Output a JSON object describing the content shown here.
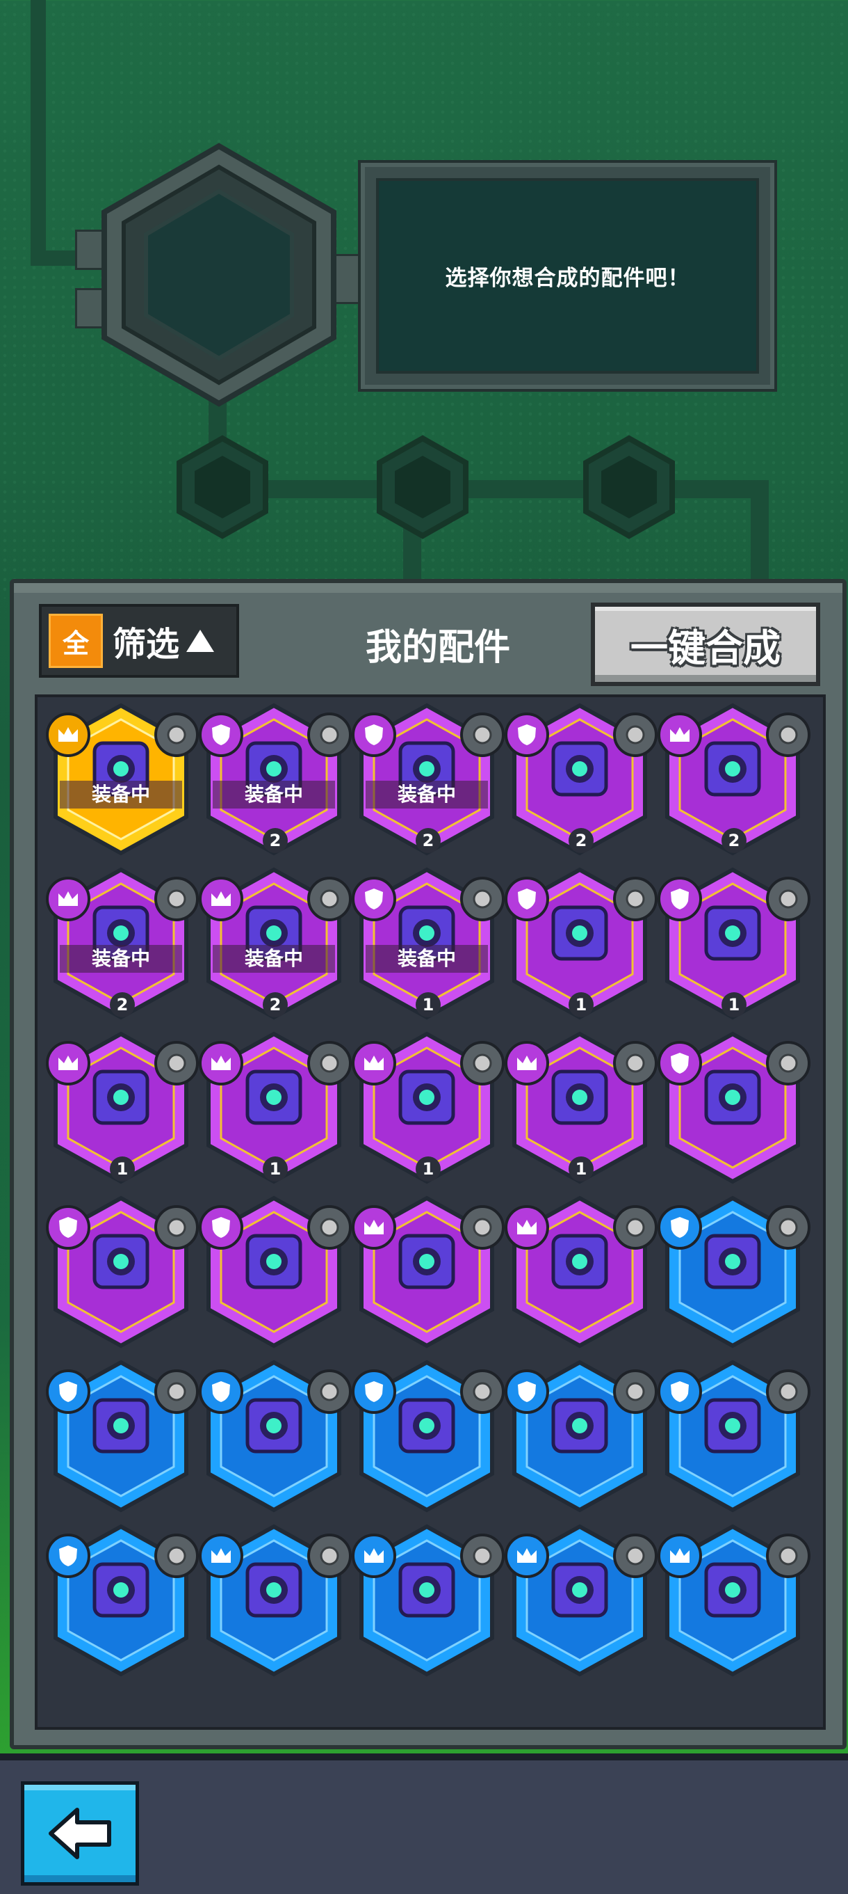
{
  "synth": {
    "prompt": "选择你想合成的配件吧！"
  },
  "panel": {
    "filter_all": "全",
    "filter_label": "筛选",
    "title": "我的配件",
    "merge_button": "一键合成"
  },
  "colors": {
    "gold": "#ffc400",
    "purple": "#b43bdc",
    "blue": "#1b8ff0",
    "accent": "#f38b0b"
  },
  "rows": [
    [
      {
        "rarity": "gold",
        "badge": "crown",
        "equipped": "装备中",
        "count": ""
      },
      {
        "rarity": "purple",
        "badge": "shield",
        "equipped": "装备中",
        "count": "2"
      },
      {
        "rarity": "purple",
        "badge": "shield",
        "equipped": "装备中",
        "count": "2"
      },
      {
        "rarity": "purple",
        "badge": "shield",
        "equipped": "",
        "count": "2"
      },
      {
        "rarity": "purple",
        "badge": "crown",
        "equipped": "",
        "count": "2"
      }
    ],
    [
      {
        "rarity": "purple",
        "badge": "crown",
        "equipped": "装备中",
        "count": "2"
      },
      {
        "rarity": "purple",
        "badge": "crown",
        "equipped": "装备中",
        "count": "2"
      },
      {
        "rarity": "purple",
        "badge": "shield",
        "equipped": "装备中",
        "count": "1"
      },
      {
        "rarity": "purple",
        "badge": "shield",
        "equipped": "",
        "count": "1"
      },
      {
        "rarity": "purple",
        "badge": "shield",
        "equipped": "",
        "count": "1"
      }
    ],
    [
      {
        "rarity": "purple",
        "badge": "crown",
        "equipped": "",
        "count": "1"
      },
      {
        "rarity": "purple",
        "badge": "crown",
        "equipped": "",
        "count": "1"
      },
      {
        "rarity": "purple",
        "badge": "crown",
        "equipped": "",
        "count": "1"
      },
      {
        "rarity": "purple",
        "badge": "crown",
        "equipped": "",
        "count": "1"
      },
      {
        "rarity": "purple",
        "badge": "shield",
        "equipped": "",
        "count": ""
      }
    ],
    [
      {
        "rarity": "purple",
        "badge": "shield",
        "equipped": "",
        "count": ""
      },
      {
        "rarity": "purple",
        "badge": "shield",
        "equipped": "",
        "count": ""
      },
      {
        "rarity": "purple",
        "badge": "crown",
        "equipped": "",
        "count": ""
      },
      {
        "rarity": "purple",
        "badge": "crown",
        "equipped": "",
        "count": ""
      },
      {
        "rarity": "blue",
        "badge": "shield",
        "equipped": "",
        "count": ""
      }
    ],
    [
      {
        "rarity": "blue",
        "badge": "shield",
        "equipped": "",
        "count": ""
      },
      {
        "rarity": "blue",
        "badge": "shield",
        "equipped": "",
        "count": ""
      },
      {
        "rarity": "blue",
        "badge": "shield",
        "equipped": "",
        "count": ""
      },
      {
        "rarity": "blue",
        "badge": "shield",
        "equipped": "",
        "count": ""
      },
      {
        "rarity": "blue",
        "badge": "shield",
        "equipped": "",
        "count": ""
      }
    ],
    [
      {
        "rarity": "blue",
        "badge": "shield",
        "equipped": "",
        "count": ""
      },
      {
        "rarity": "blue",
        "badge": "crown",
        "equipped": "",
        "count": ""
      },
      {
        "rarity": "blue",
        "badge": "crown",
        "equipped": "",
        "count": ""
      },
      {
        "rarity": "blue",
        "badge": "crown",
        "equipped": "",
        "count": ""
      },
      {
        "rarity": "blue",
        "badge": "crown",
        "equipped": "",
        "count": ""
      }
    ]
  ]
}
